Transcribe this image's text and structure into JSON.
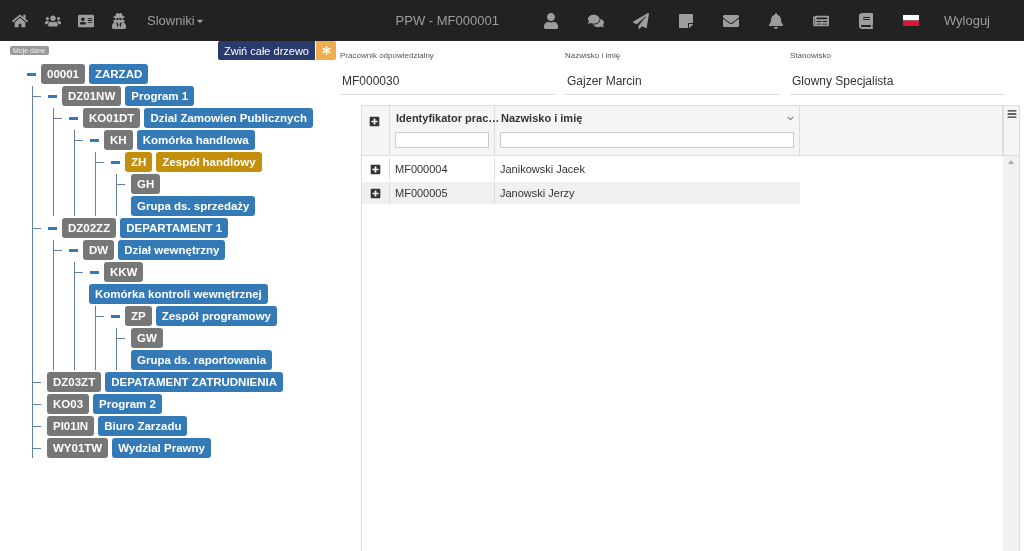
{
  "navbar": {
    "menu": "Slowniki",
    "title": "PPW - MF000001",
    "logout": "Wyloguj"
  },
  "tree": {
    "tooltip": "Moje dane",
    "collapse_button": "Zwiń całe drzewo",
    "nodes": [
      {
        "code": "00001",
        "name": "ZARZAD",
        "kind": "inline",
        "expanded": true,
        "selected": false,
        "children": [
          {
            "code": "DZ01NW",
            "name": "Program 1",
            "kind": "inline",
            "expanded": true,
            "selected": false,
            "children": [
              {
                "code": "KO01DT",
                "name": "Dzial Zamowien Publicznych",
                "kind": "inline",
                "expanded": true,
                "selected": false,
                "children": [
                  {
                    "code": "KH",
                    "name": "Komórka handlowa",
                    "kind": "inline",
                    "expanded": true,
                    "selected": false,
                    "children": [
                      {
                        "code": "ZH",
                        "name": "Zespół handlowy",
                        "kind": "inline",
                        "expanded": true,
                        "selected": true,
                        "children": [
                          {
                            "code": "GH",
                            "name": "Grupa ds. sprzedaży",
                            "kind": "stacked",
                            "selected": false
                          }
                        ]
                      }
                    ]
                  }
                ]
              }
            ]
          },
          {
            "code": "DZ02ZZ",
            "name": "DEPARTAMENT 1",
            "kind": "inline",
            "expanded": true,
            "selected": false,
            "children": [
              {
                "code": "DW",
                "name": "Dział wewnętrzny",
                "kind": "inline",
                "expanded": true,
                "selected": false,
                "children": [
                  {
                    "code": "KKW",
                    "name": "Komórka kontroli wewnętrznej",
                    "kind": "stacked",
                    "expanded": true,
                    "selected": false,
                    "children": [
                      {
                        "code": "ZP",
                        "name": "Zespół programowy",
                        "kind": "inline",
                        "expanded": true,
                        "selected": false,
                        "children": [
                          {
                            "code": "GW",
                            "name": "Grupa ds. raportowania",
                            "kind": "stacked",
                            "selected": false
                          }
                        ]
                      }
                    ]
                  }
                ]
              }
            ]
          },
          {
            "code": "DZ03ZT",
            "name": "DEPATAMENT ZATRUDNIENIA",
            "kind": "inline",
            "selected": false
          },
          {
            "code": "KO03",
            "name": "Program 2",
            "kind": "inline",
            "selected": false
          },
          {
            "code": "PI01IN",
            "name": "Biuro Zarzadu",
            "kind": "inline",
            "selected": false
          },
          {
            "code": "WY01TW",
            "name": "Wydzial Prawny",
            "kind": "inline",
            "selected": false
          }
        ]
      }
    ]
  },
  "details": {
    "fields": [
      {
        "label": "Pracownik odpowiedzialny",
        "value": "MF000030"
      },
      {
        "label": "Nazwisko i imię",
        "value": "Gajzer Marcin"
      },
      {
        "label": "Stanowisko",
        "value": "Glowny Specjalista"
      }
    ]
  },
  "grid": {
    "columns": [
      "Identyfikator prac…",
      "Nazwisko i imię"
    ],
    "rows": [
      {
        "cells": [
          "MF000004",
          "Janikowski Jacek"
        ]
      },
      {
        "cells": [
          "MF000005",
          "Janowski Jerzy"
        ]
      }
    ]
  }
}
